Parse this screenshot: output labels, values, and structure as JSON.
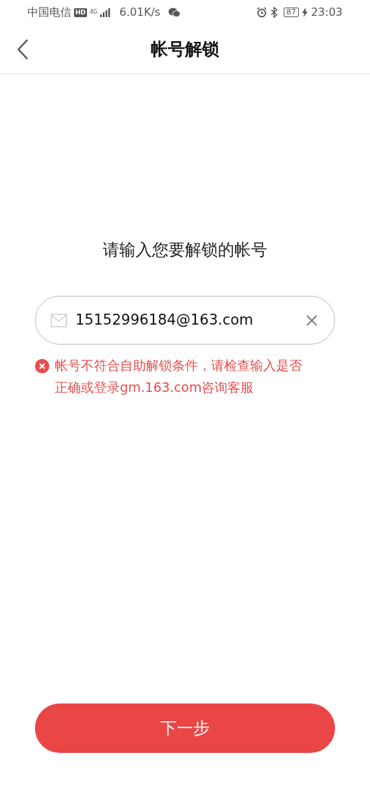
{
  "status_bar": {
    "carrier": "中国电信",
    "hd": "HD",
    "network": "4G",
    "speed": "6.01K/s",
    "battery": "87",
    "time": "23:03"
  },
  "header": {
    "title": "帐号解锁"
  },
  "prompt": "请输入您要解锁的帐号",
  "account_field": {
    "value": "15152996184@163.com"
  },
  "error": {
    "message": "帐号不符合自助解锁条件，请检查输入是否正确或登录gm.163.com咨询客服"
  },
  "next_button": {
    "label": "下一步"
  }
}
